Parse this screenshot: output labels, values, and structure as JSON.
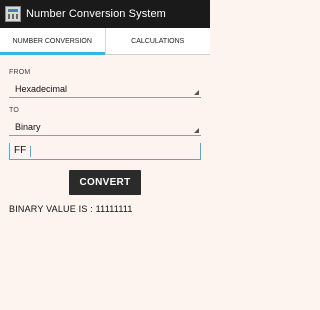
{
  "window": {
    "title": "Number Conversion System",
    "icon": "calculator-app-icon"
  },
  "tabs": [
    {
      "label": "NUMBER CONVERSION",
      "active": true
    },
    {
      "label": "CALCULATIONS",
      "active": false
    }
  ],
  "form": {
    "from_label": "FROM",
    "from_value": "Hexadecimal",
    "to_label": "TO",
    "to_value": "Binary",
    "input_value": "FF",
    "convert_label": "CONVERT"
  },
  "result": {
    "text": "BINARY VALUE IS : 11111111"
  },
  "colors": {
    "accent": "#33b5e5",
    "titlebar": "#1a1a1a",
    "background": "#fdf3ef",
    "button": "#2b2b2b"
  }
}
